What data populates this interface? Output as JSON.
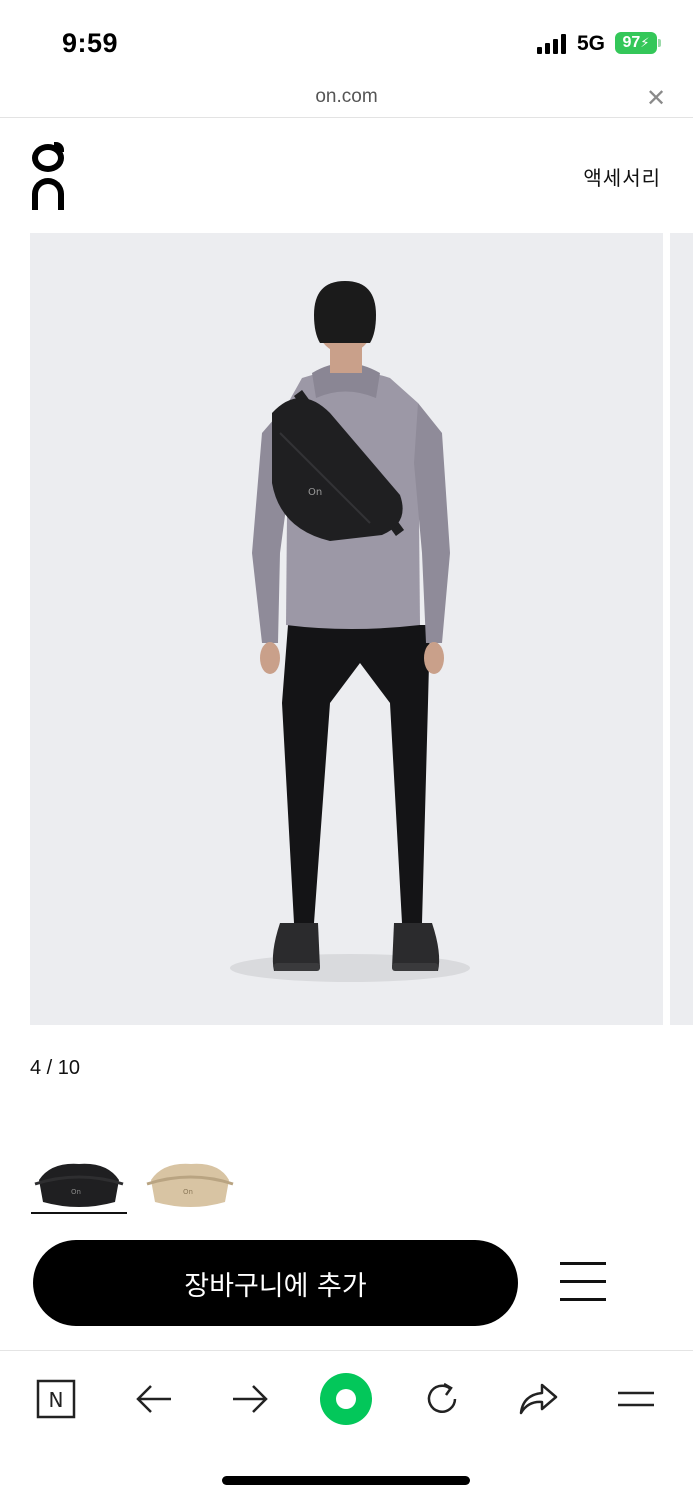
{
  "status_bar": {
    "time": "9:59",
    "network": "5G",
    "battery": "97"
  },
  "url_bar": {
    "domain": "on.com",
    "close_icon": "close-icon"
  },
  "header": {
    "logo_icon": "on-logo",
    "category_link": "액세서리"
  },
  "gallery": {
    "counter": "4 / 10",
    "background_color": "#ecedf0"
  },
  "color_options": {
    "selected_index": 0,
    "swatches": [
      {
        "icon": "black-bag-thumbnail",
        "color": "#1f1f21"
      },
      {
        "icon": "sand-bag-thumbnail",
        "color": "#d8c4a3"
      }
    ]
  },
  "actions": {
    "add_to_cart": "장바구니에 추가",
    "menu_icon": "hamburger-menu-icon"
  },
  "browser_toolbar": {
    "items": [
      {
        "icon": "naver-home-icon",
        "label": "N"
      },
      {
        "icon": "back-arrow-icon"
      },
      {
        "icon": "forward-arrow-icon"
      },
      {
        "icon": "green-circle-icon",
        "color": "#03c75a"
      },
      {
        "icon": "reload-icon"
      },
      {
        "icon": "share-icon"
      },
      {
        "icon": "menu-icon"
      }
    ]
  }
}
